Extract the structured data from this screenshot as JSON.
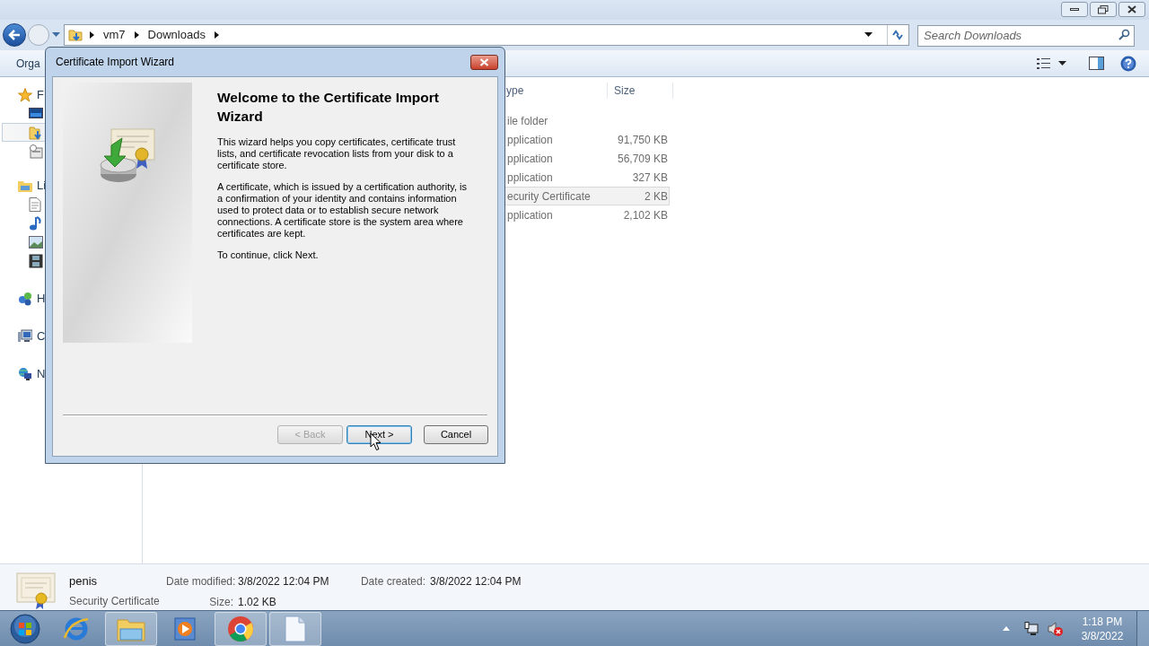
{
  "address_bar": {
    "path": [
      "vm7",
      "Downloads"
    ]
  },
  "search": {
    "placeholder": "Search Downloads"
  },
  "toolbar": {
    "organize": "Orga"
  },
  "nav_pane": {
    "groups": [
      {
        "label": "F",
        "kind": "favorites",
        "items": [
          {
            "kind": "desktop",
            "selected": false
          },
          {
            "kind": "downloads",
            "selected": true
          },
          {
            "kind": "recent",
            "selected": false
          }
        ]
      },
      {
        "label": "Li",
        "kind": "libraries",
        "items": [
          {
            "kind": "documents",
            "selected": false
          },
          {
            "kind": "music",
            "selected": false
          },
          {
            "kind": "pictures",
            "selected": false
          },
          {
            "kind": "videos",
            "selected": false
          }
        ]
      },
      {
        "label": "H",
        "kind": "homegroup"
      },
      {
        "label": "C",
        "kind": "computer"
      },
      {
        "label": "N",
        "kind": "network"
      }
    ]
  },
  "file_list": {
    "columns": [
      "ype",
      "Size"
    ],
    "rows": [
      {
        "type": "ile folder",
        "selected": false
      },
      {
        "type": "pplication",
        "size": "91,750 KB",
        "selected": false
      },
      {
        "type": "pplication",
        "size": "56,709 KB",
        "selected": false
      },
      {
        "type": "pplication",
        "size": "327 KB",
        "selected": false
      },
      {
        "type": "ecurity Certificate",
        "size": "2 KB",
        "selected": true
      },
      {
        "type": "pplication",
        "size": "2,102 KB",
        "selected": false
      }
    ]
  },
  "dialog": {
    "title": "Certificate Import Wizard",
    "heading": "Welcome to the Certificate Import Wizard",
    "paragraphs": [
      "This wizard helps you copy certificates, certificate trust lists, and certificate revocation lists from your disk to a certificate store.",
      "A certificate, which is issued by a certification authority, is a confirmation of your identity and contains information used to protect data or to establish secure network connections. A certificate store is the system area where certificates are kept.",
      "To continue, click Next."
    ],
    "buttons": [
      {
        "label": "< Back",
        "disabled": true,
        "default": false
      },
      {
        "label": "Next >",
        "disabled": false,
        "default": true
      },
      {
        "label": "Cancel",
        "disabled": false,
        "default": false
      }
    ]
  },
  "details": {
    "name": "penis",
    "type": "Security Certificate",
    "fields": [
      {
        "label": "Date modified:",
        "value": "3/8/2022 12:04 PM"
      },
      {
        "label": "Size:",
        "value": "1.02 KB"
      },
      {
        "label": "Date created:",
        "value": "3/8/2022 12:04 PM"
      }
    ]
  },
  "taskbar": {
    "apps": [
      {
        "kind": "browser",
        "active": false
      },
      {
        "kind": "folder",
        "active": true
      },
      {
        "kind": "media",
        "active": false
      },
      {
        "kind": "chrome",
        "active": true
      },
      {
        "kind": "document",
        "active": true
      }
    ],
    "time": "1:18 PM",
    "date": "3/8/2022"
  }
}
